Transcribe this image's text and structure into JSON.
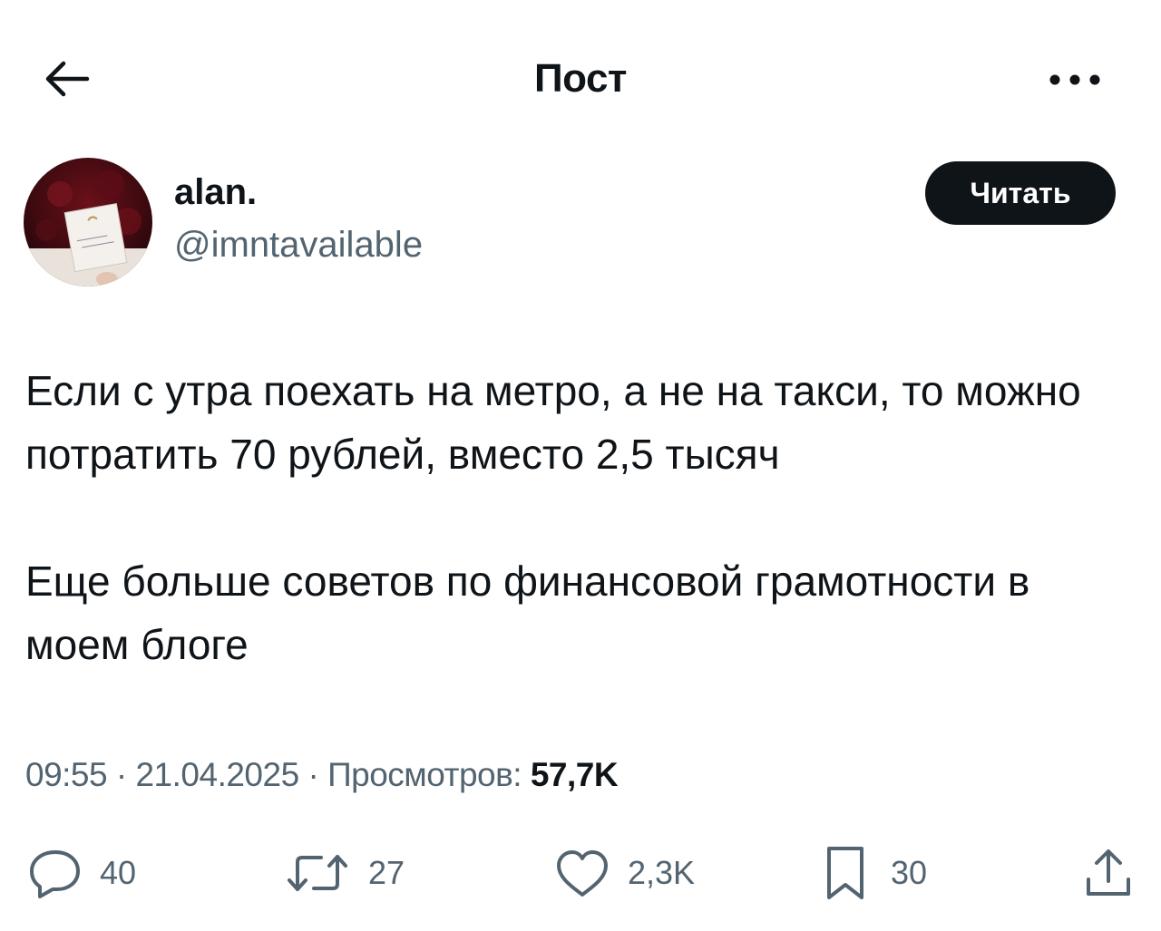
{
  "header": {
    "title": "Пост",
    "back_icon": "arrow-left-icon",
    "more_icon": "more-horizontal-icon"
  },
  "author": {
    "display_name": "alan.",
    "handle": "@imntavailable",
    "follow_label": "Читать"
  },
  "tweet": {
    "paragraphs": [
      "Если с утра поехать на метро, а не на такси, то можно потратить 70 рублей, вместо 2,5 тысяч",
      "Еще больше советов по финансовой грамотности в моем блоге"
    ],
    "time": "09:55",
    "date": "21.04.2025",
    "views_label": "Просмотров:",
    "views_count": "57,7K",
    "separator": "·"
  },
  "actions": {
    "replies": "40",
    "reposts": "27",
    "likes": "2,3K",
    "bookmarks": "30"
  },
  "colors": {
    "text": "#0f1419",
    "secondary": "#536471",
    "button_bg": "#0f1419"
  }
}
